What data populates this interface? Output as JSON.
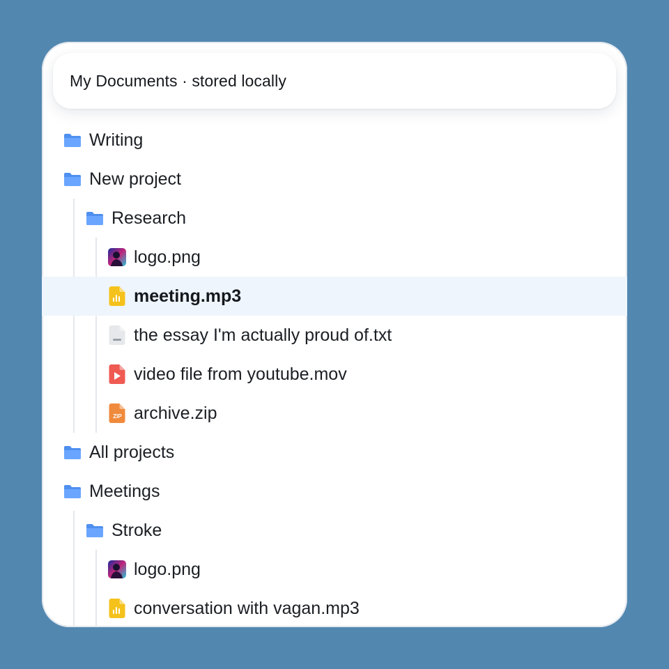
{
  "header": {
    "title": "My Documents · stored locally"
  },
  "tree": [
    {
      "label": "Writing",
      "kind": "folder",
      "level": 0,
      "selected": false
    },
    {
      "label": "New project",
      "kind": "folder",
      "level": 0,
      "selected": false
    },
    {
      "label": "Research",
      "kind": "folder",
      "level": 1,
      "selected": false
    },
    {
      "label": "logo.png",
      "kind": "image",
      "level": 2,
      "selected": false
    },
    {
      "label": "meeting.mp3",
      "kind": "audio",
      "level": 2,
      "selected": true
    },
    {
      "label": "the essay I'm actually proud of.txt",
      "kind": "text",
      "level": 2,
      "selected": false
    },
    {
      "label": "video file from youtube.mov",
      "kind": "video",
      "level": 2,
      "selected": false
    },
    {
      "label": "archive.zip",
      "kind": "archive",
      "level": 2,
      "selected": false
    },
    {
      "label": "All projects",
      "kind": "folder",
      "level": 0,
      "selected": false
    },
    {
      "label": "Meetings",
      "kind": "folder",
      "level": 0,
      "selected": false
    },
    {
      "label": "Stroke",
      "kind": "folder",
      "level": 1,
      "selected": false
    },
    {
      "label": "logo.png",
      "kind": "image",
      "level": 2,
      "selected": false
    },
    {
      "label": "conversation with vagan.mp3",
      "kind": "audio",
      "level": 2,
      "selected": false
    }
  ],
  "icons": {
    "folder": "folder-icon",
    "image": "image-file-icon",
    "audio": "audio-file-icon",
    "text": "text-file-icon",
    "video": "video-file-icon",
    "archive": "zip-file-icon",
    "zip_label": "ZIP"
  },
  "colors": {
    "background": "#5287b0",
    "folder": "#4f8ff0",
    "audio": "#f5c21c",
    "video": "#ef5a52",
    "archive": "#f08a3c",
    "text": "#c9ccd1",
    "selected_row": "#eef5fc"
  }
}
